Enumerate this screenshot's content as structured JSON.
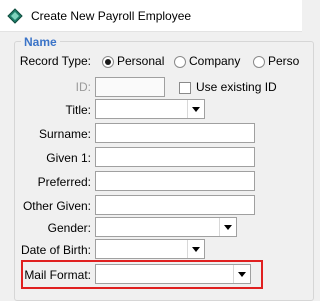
{
  "window": {
    "title": "Create New Payroll Employee"
  },
  "group": {
    "legend": "Name"
  },
  "record_type": {
    "label": "Record Type:",
    "options": [
      "Personal",
      "Company",
      "Perso"
    ],
    "selected": "Personal"
  },
  "id_field": {
    "label": "ID:",
    "value": ""
  },
  "use_existing_id": {
    "label": "Use existing ID",
    "checked": false
  },
  "fields": {
    "title": {
      "label": "Title:",
      "value": ""
    },
    "surname": {
      "label": "Surname:",
      "value": ""
    },
    "given1": {
      "label": "Given 1:",
      "value": ""
    },
    "preferred": {
      "label": "Preferred:",
      "value": ""
    },
    "other_given": {
      "label": "Other Given:",
      "value": ""
    },
    "gender": {
      "label": "Gender:",
      "value": ""
    },
    "date_of_birth": {
      "label": "Date of Birth:",
      "value": ""
    },
    "mail_format": {
      "label": "Mail Format:",
      "value": ""
    }
  },
  "colors": {
    "legend": "#3b74c8",
    "highlight": "#e02020"
  },
  "icons": {
    "app": "payroll-diamond-icon"
  }
}
